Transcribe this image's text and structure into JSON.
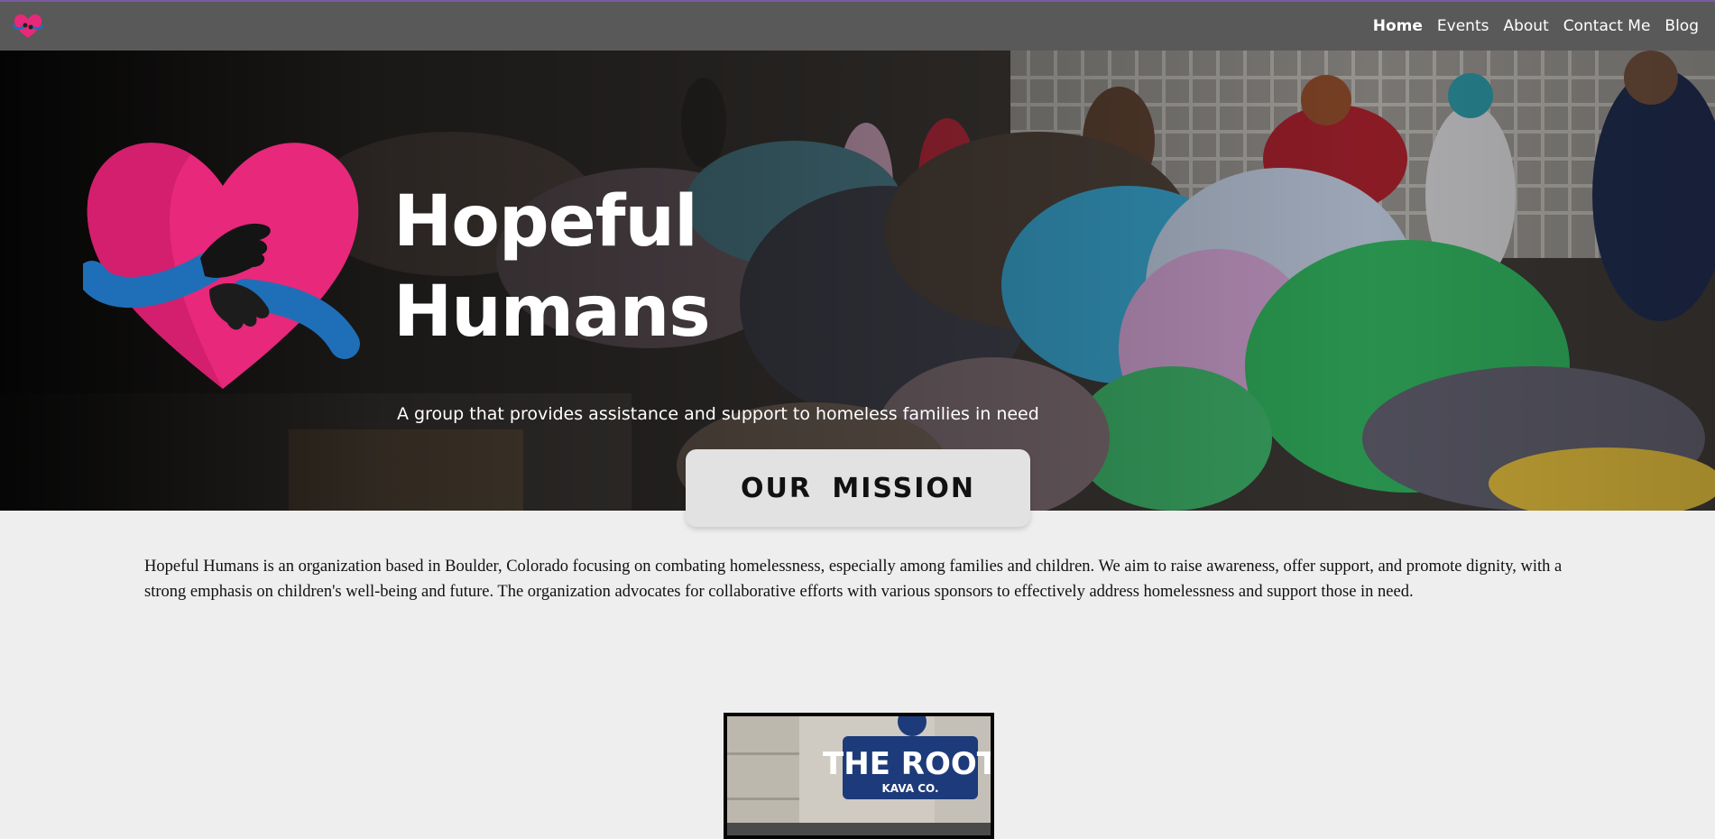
{
  "nav": {
    "logo_icon": "heart-hug-logo-icon",
    "links": [
      {
        "label": "Home",
        "active": true
      },
      {
        "label": "Events",
        "active": false
      },
      {
        "label": "About",
        "active": false
      },
      {
        "label": "Contact Me",
        "active": false
      },
      {
        "label": "Blog",
        "active": false
      }
    ]
  },
  "hero": {
    "title_line1": "Hopeful",
    "title_line2": "Humans",
    "subtitle": "A group that provides assistance and support to homeless families in need",
    "logo_icon": "heart-hug-icon"
  },
  "mission": {
    "button_label": "OUR  MISSION",
    "text": "Hopeful Humans is an organization based in Boulder, Colorado focusing on combating homelessness, especially among families and children. We aim to raise awareness, offer support, and promote dignity, with a strong emphasis on children's well-being and future. The organization advocates for collaborative efforts with various sponsors to effectively address homelessness and support those in need."
  },
  "sponsor": {
    "sign_line1": "THE ROOT",
    "sign_line2": "KAVA CO."
  },
  "colors": {
    "nav_bg": "#595959",
    "heart_pink": "#e8287a",
    "arm_blue": "#1f6fb8",
    "page_bg": "#eeeeee"
  }
}
